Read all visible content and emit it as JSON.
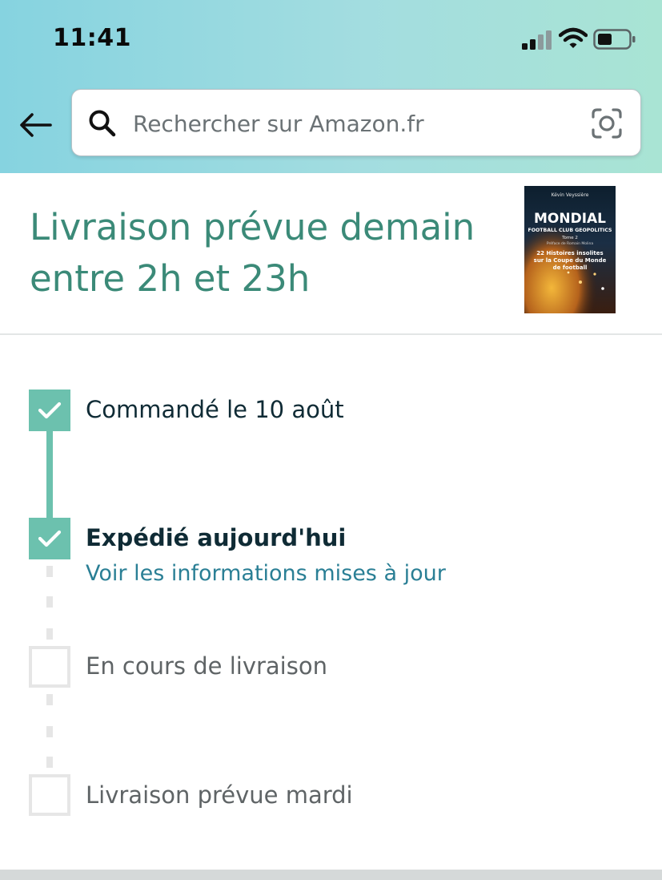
{
  "status_bar": {
    "time": "11:41"
  },
  "search": {
    "placeholder": "Rechercher sur Amazon.fr"
  },
  "delivery": {
    "title_line1": "Livraison prévue demain",
    "title_line2": "entre 2h et 23h"
  },
  "product": {
    "author": "Kévin Veyssière",
    "title": "MONDIAL",
    "subtitle": "FOOTBALL CLUB GEOPOLITICS",
    "volume": "Tome 2",
    "preface": "Préface de Romain Molina",
    "tagline_line1": "22 Histoires insolites",
    "tagline_line2": "sur la Coupe du Monde",
    "tagline_line3": "de football"
  },
  "tracking": {
    "steps": [
      {
        "label": "Commandé le 10 août",
        "status": "done"
      },
      {
        "label": "Expédié aujourd'hui",
        "status": "done"
      },
      {
        "label": "En cours de livraison",
        "status": "pending"
      },
      {
        "label": "Livraison prévue mardi",
        "status": "pending"
      }
    ],
    "update_link": "Voir les informations mises à jour"
  },
  "colors": {
    "accent_green": "#6cc1ae",
    "title_green": "#3b8a78",
    "link_blue": "#2a7f95"
  }
}
